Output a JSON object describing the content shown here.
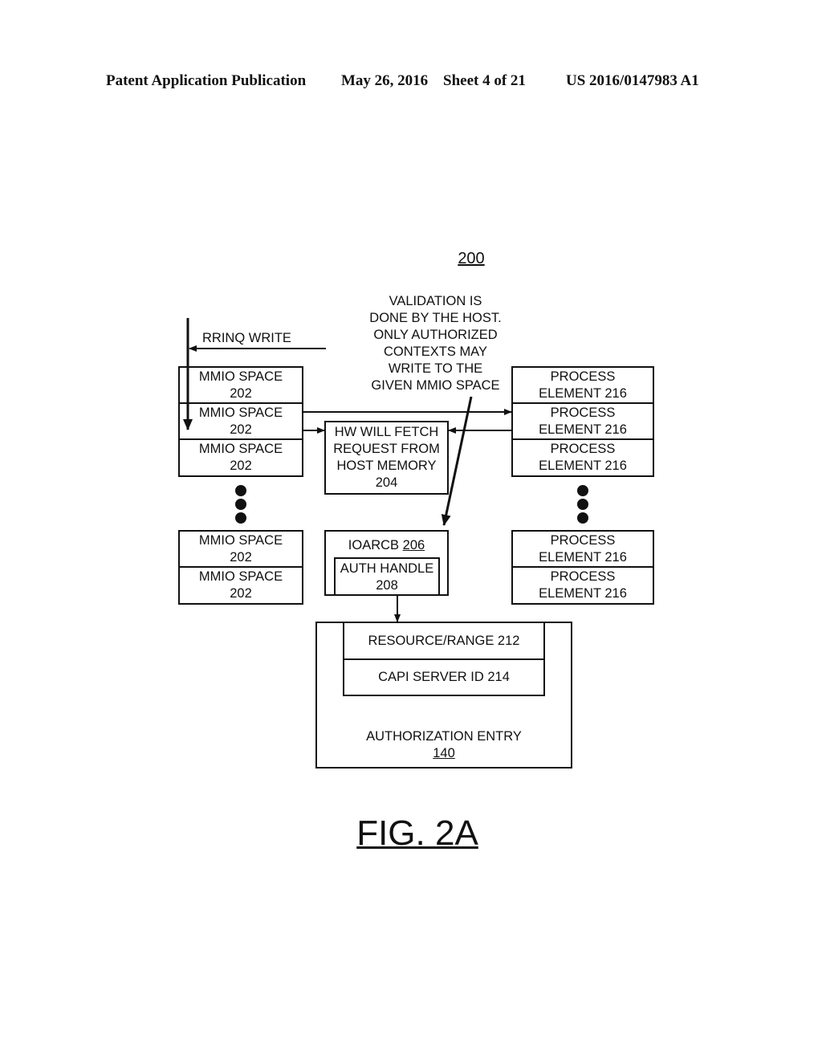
{
  "header": {
    "publication": "Patent Application Publication",
    "date": "May 26, 2016",
    "sheet": "Sheet 4 of 21",
    "number": "US 2016/0147983 A1"
  },
  "figure": {
    "ref": "200",
    "caption": "FIG. 2A",
    "note_lines": [
      "VALIDATION IS",
      "DONE BY THE HOST.",
      "ONLY AUTHORIZED",
      "CONTEXTS MAY",
      "WRITE TO THE",
      "GIVEN MMIO SPACE"
    ],
    "rrinq_label": "RRINQ WRITE",
    "mmio": {
      "line1": "MMIO SPACE",
      "line2": "202"
    },
    "process": {
      "line1": "PROCESS",
      "line2": "ELEMENT 216"
    },
    "hw_fetch": [
      "HW WILL FETCH",
      "REQUEST FROM",
      "HOST MEMORY",
      "204"
    ],
    "ioarcb": {
      "label": "IOARCB",
      "ref": "206"
    },
    "auth_handle": [
      "AUTH HANDLE",
      "208"
    ],
    "resource_range": "RESOURCE/RANGE 212",
    "capi_server": "CAPI SERVER ID 214",
    "auth_entry": {
      "label": "AUTHORIZATION ENTRY",
      "ref": "140"
    }
  }
}
